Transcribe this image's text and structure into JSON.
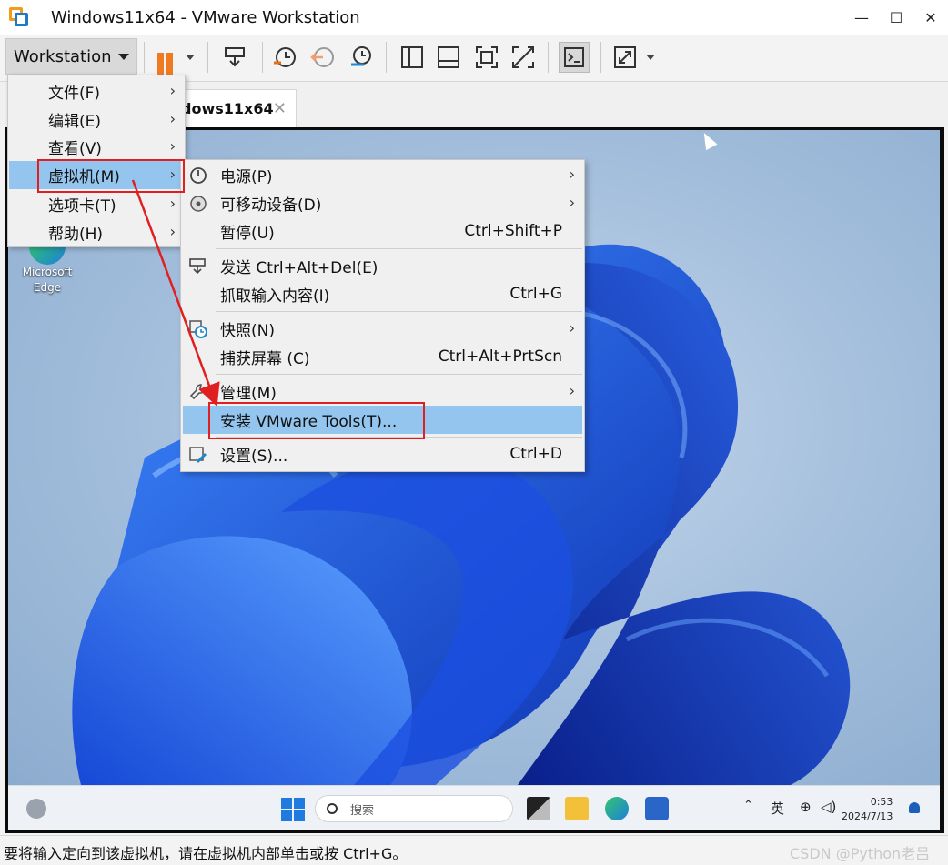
{
  "window": {
    "title": "Windows11x64 - VMware Workstation",
    "controls": {
      "minimize": "—",
      "maximize": "☐",
      "close": "✕"
    }
  },
  "toolbar": {
    "workstation_label": "Workstation"
  },
  "tab": {
    "label": "dows11x64",
    "close": "✕"
  },
  "main_menu": {
    "items": [
      {
        "label": "文件(F)",
        "arrow": "›"
      },
      {
        "label": "编辑(E)",
        "arrow": "›"
      },
      {
        "label": "查看(V)",
        "arrow": "›"
      },
      {
        "label": "虚拟机(M)",
        "arrow": "›"
      },
      {
        "label": "选项卡(T)",
        "arrow": "›"
      },
      {
        "label": "帮助(H)",
        "arrow": "›"
      }
    ]
  },
  "vm_menu": {
    "items": [
      {
        "label": "电源(P)",
        "arrow": "›",
        "icon": "power-icon"
      },
      {
        "label": "可移动设备(D)",
        "arrow": "›",
        "icon": "disc-icon"
      },
      {
        "label": "暂停(U)",
        "shortcut": "Ctrl+Shift+P"
      },
      {
        "label": "发送 Ctrl+Alt+Del(E)",
        "icon": "send-keys-icon"
      },
      {
        "label": "抓取输入内容(I)",
        "shortcut": "Ctrl+G"
      },
      {
        "label": "快照(N)",
        "arrow": "›",
        "icon": "snapshot-icon"
      },
      {
        "label": "捕获屏幕 (C)",
        "shortcut": "Ctrl+Alt+PrtScn"
      },
      {
        "label": "管理(M)",
        "arrow": "›",
        "icon": "wrench-icon"
      },
      {
        "label": "安装 VMware Tools(T)..."
      },
      {
        "label": "设置(S)...",
        "shortcut": "Ctrl+D",
        "icon": "settings-icon"
      }
    ]
  },
  "desktop": {
    "icons": [
      {
        "label_line1": "Microsoft",
        "label_line2": "Edge"
      }
    ]
  },
  "guest_taskbar": {
    "search_placeholder": "搜索",
    "ime": "英",
    "time": "0:53",
    "date": "2024/7/13"
  },
  "statusbar": {
    "text": "要将输入定向到该虚拟机，请在虚拟机内部单击或按 Ctrl+G。",
    "watermark": "CSDN @Python老吕"
  },
  "colors": {
    "menu_highlight": "#93c5ee",
    "annotation_red": "#e02020",
    "pause_orange": "#f07a22"
  }
}
